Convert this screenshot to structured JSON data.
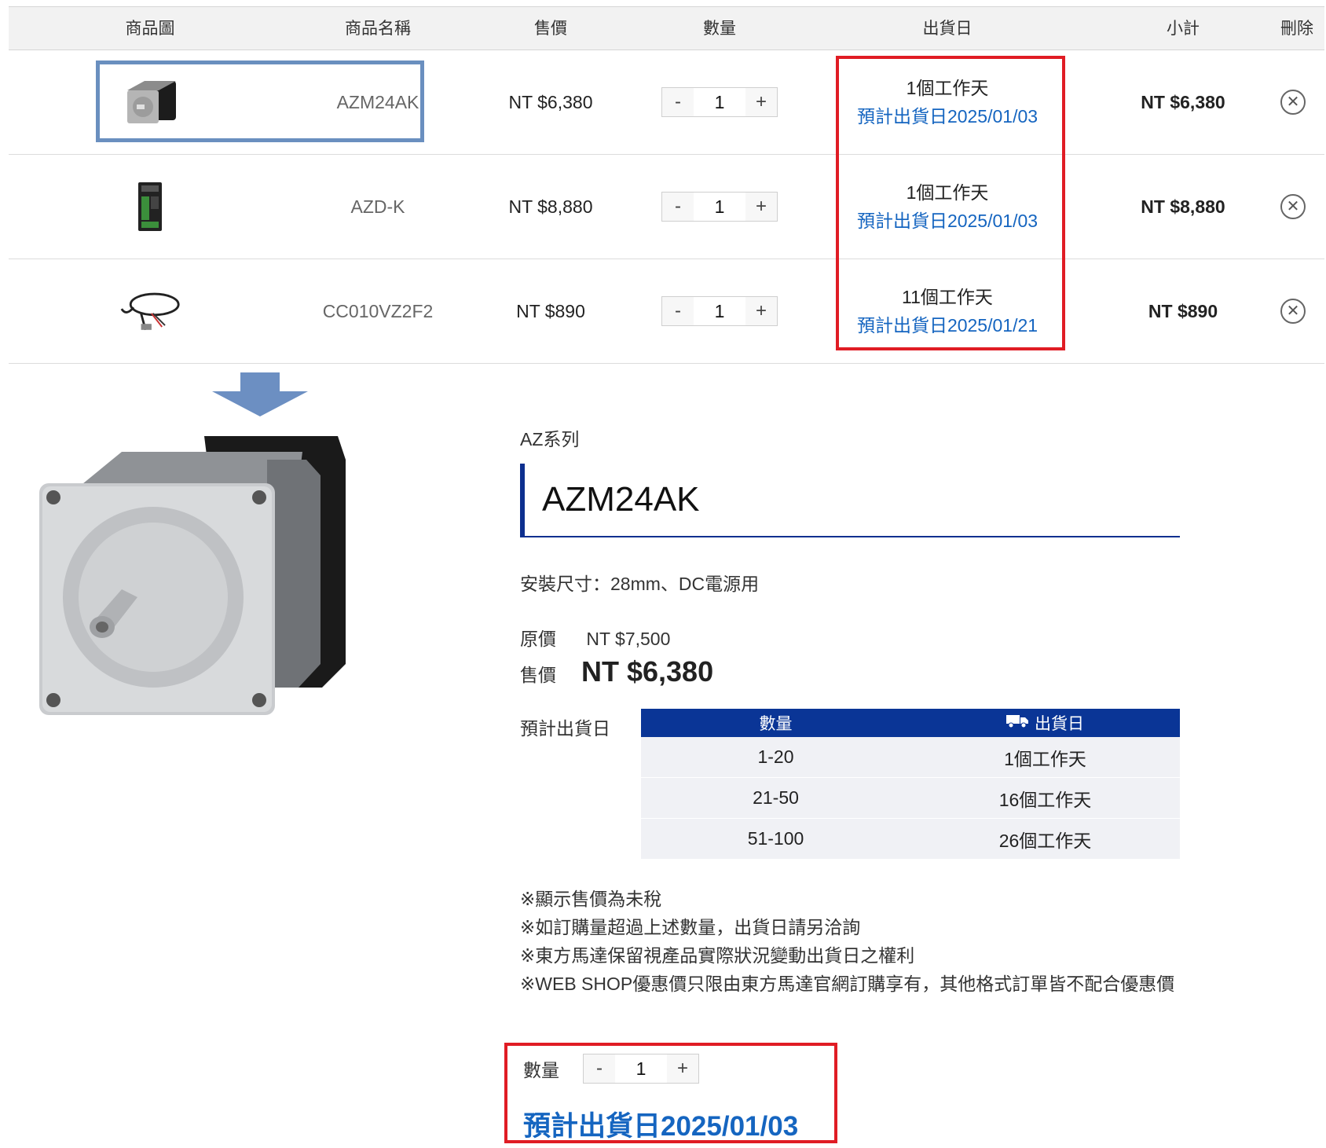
{
  "cart": {
    "headers": [
      "商品圖",
      "商品名稱",
      "售價",
      "數量",
      "出貨日",
      "小計",
      "刪除"
    ],
    "rows": [
      {
        "name": "AZM24AK",
        "price": "NT $6,380",
        "qty": "1",
        "ship_days": "1個工作天",
        "ship_date": "預計出貨日2025/01/03",
        "subtotal": "NT $6,380",
        "image": "stepping-motor-icon"
      },
      {
        "name": "AZD-K",
        "price": "NT $8,880",
        "qty": "1",
        "ship_days": "1個工作天",
        "ship_date": "預計出貨日2025/01/03",
        "subtotal": "NT $8,880",
        "image": "driver-icon"
      },
      {
        "name": "CC010VZ2F2",
        "price": "NT $890",
        "qty": "1",
        "ship_days": "11個工作天",
        "ship_date": "預計出貨日2025/01/21",
        "subtotal": "NT $890",
        "image": "cable-icon"
      }
    ],
    "minus": "-",
    "plus": "+",
    "delete_glyph": "✕"
  },
  "product": {
    "series": "AZ系列",
    "title": "AZM24AK",
    "spec": "安裝尺寸：28mm、DC電源用",
    "orig_label": "原價",
    "orig_price": "NT $7,500",
    "sale_label": "售價",
    "sale_price": "NT $6,380",
    "ship_label": "預計出貨日",
    "ship_table": {
      "headers": [
        "數量",
        "出貨日"
      ],
      "rows": [
        [
          "1-20",
          "1個工作天"
        ],
        [
          "21-50",
          "16個工作天"
        ],
        [
          "51-100",
          "26個工作天"
        ]
      ]
    },
    "notes": [
      "※顯示售價為未稅",
      "※如訂購量超過上述數量，出貨日請另洽詢",
      "※東方馬達保留視產品實際狀況變動出貨日之權利",
      "※WEB SHOP優惠價只限由東方馬達官網訂購享有，其他格式訂單皆不配合優惠價"
    ],
    "qty_label": "數量",
    "qty": "1",
    "est_ship": "預計出貨日2025/01/03"
  },
  "colors": {
    "accent_blue": "#1565c0",
    "header_navy": "#0a3596",
    "highlight_red": "#e01c24",
    "highlight_blue": "#6a8fbf"
  }
}
